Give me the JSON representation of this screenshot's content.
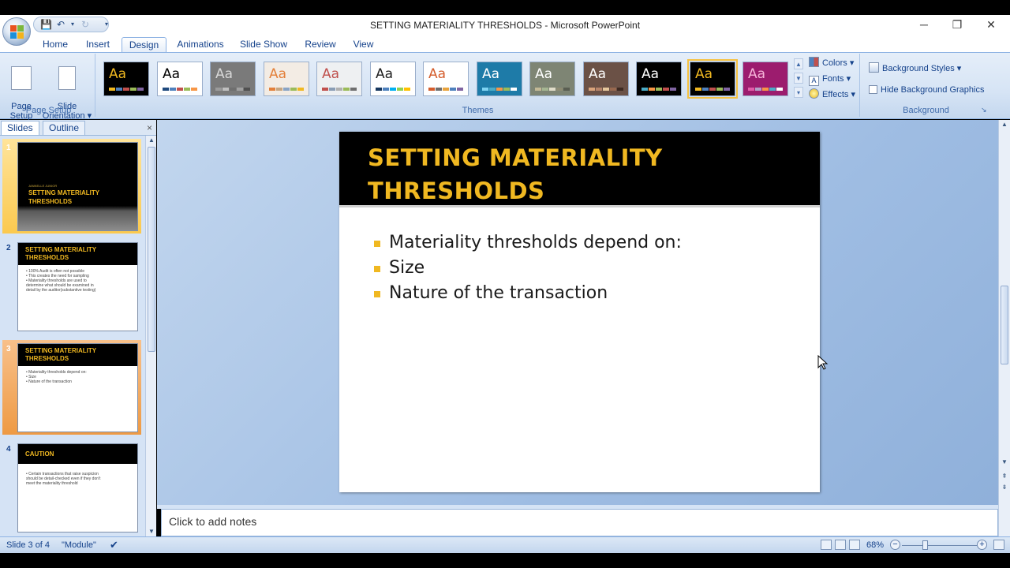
{
  "window": {
    "title": "SETTING MATERIALITY THRESHOLDS - Microsoft PowerPoint",
    "minimize": "─",
    "restore": "❐",
    "close": "✕"
  },
  "qat": {
    "save": "💾",
    "undo": "↶",
    "redo": "↻",
    "more": "▾"
  },
  "ribbon": {
    "tabs": [
      {
        "label": "Home"
      },
      {
        "label": "Insert"
      },
      {
        "label": "Design"
      },
      {
        "label": "Animations"
      },
      {
        "label": "Slide Show"
      },
      {
        "label": "Review"
      },
      {
        "label": "View"
      }
    ],
    "active_tab": "Design",
    "page_setup": {
      "page_setup_label": "Page\nSetup",
      "orientation_label": "Slide\nOrientation ▾",
      "group_label": "Page Setup"
    },
    "themes": {
      "group_label": "Themes",
      "items": [
        {
          "aa": "Aa",
          "bg": "#000000",
          "fg": "#f0b821",
          "bars": [
            "#f0b821",
            "#4f81bd",
            "#c0504d",
            "#9bbb59",
            "#8064a2"
          ]
        },
        {
          "aa": "Aa",
          "bg": "#ffffff",
          "fg": "#000000",
          "bars": [
            "#1f497d",
            "#4f81bd",
            "#c0504d",
            "#9bbb59",
            "#f79646"
          ]
        },
        {
          "aa": "Aa",
          "bg": "#7a7a7a",
          "fg": "#d8d8d8",
          "bars": [
            "#9b9b9b",
            "#c0c0c0",
            "#6f6f6f",
            "#a0a0a0",
            "#505050"
          ]
        },
        {
          "aa": "Aa",
          "bg": "#f3ece4",
          "fg": "#e3803a",
          "bars": [
            "#e3803a",
            "#c6a681",
            "#8aa4c4",
            "#9bbb59",
            "#f0b821"
          ]
        },
        {
          "aa": "Aa",
          "bg": "#eef0f2",
          "fg": "#c0504d",
          "bars": [
            "#c0504d",
            "#8a9db5",
            "#b0b0b0",
            "#9bbb59",
            "#6f6f6f"
          ]
        },
        {
          "aa": "Aa",
          "bg": "#ffffff",
          "fg": "#1f1f1f",
          "bars": [
            "#17375e",
            "#4f81bd",
            "#00b0f0",
            "#92d050",
            "#ffc000"
          ]
        },
        {
          "aa": "Aa",
          "bg": "#ffffff",
          "fg": "#d45d2c",
          "bars": [
            "#d45d2c",
            "#6e6e6e",
            "#e8a33d",
            "#4f81bd",
            "#8064a2"
          ]
        },
        {
          "aa": "Aa",
          "bg": "#1e7ba8",
          "fg": "#ffffff",
          "bars": [
            "#7fd3f2",
            "#4bacc6",
            "#f79646",
            "#9bbb59",
            "#ffffff"
          ]
        },
        {
          "aa": "Aa",
          "bg": "#7e8574",
          "fg": "#ffffff",
          "bars": [
            "#c3b996",
            "#a5b592",
            "#e0dcc9",
            "#8d8b73",
            "#5a5e52"
          ]
        },
        {
          "aa": "Aa",
          "bg": "#6b5146",
          "fg": "#ffffff",
          "bars": [
            "#d9a37b",
            "#b6846a",
            "#e5c79d",
            "#97684f",
            "#3e2a22"
          ]
        },
        {
          "aa": "Aa",
          "bg": "#000000",
          "fg": "#ffffff",
          "bars": [
            "#4bacc6",
            "#f79646",
            "#9bbb59",
            "#c0504d",
            "#8064a2"
          ]
        },
        {
          "aa": "Aa",
          "bg": "#000000",
          "fg": "#f0b821",
          "bars": [
            "#f0b821",
            "#4f81bd",
            "#c0504d",
            "#9bbb59",
            "#8064a2"
          ]
        },
        {
          "aa": "Aa",
          "bg": "#9c1c6e",
          "fg": "#f6b3d8",
          "bars": [
            "#e25ca9",
            "#b2a2c7",
            "#f79646",
            "#4bacc6",
            "#ffffff"
          ]
        }
      ],
      "selected_index": 11,
      "colors_label": "Colors ▾",
      "fonts_label": "Fonts ▾",
      "effects_label": "Effects ▾"
    },
    "background": {
      "styles_label": "Background Styles ▾",
      "hide_graphics_label": "Hide Background Graphics",
      "hide_graphics_checked": false,
      "group_label": "Background",
      "launcher": "↘"
    }
  },
  "slides_pane": {
    "tab_slides": "Slides",
    "tab_outline": "Outline",
    "close": "×",
    "thumbnails": [
      {
        "num": "1",
        "title": "SETTING MATERIALITY\nTHRESHOLDS",
        "subtitle": "JANNELLE JUNIOR",
        "lines": []
      },
      {
        "num": "2",
        "title": "SETTING MATERIALITY\nTHRESHOLDS",
        "lines": [
          "• 100% Audit is often not possible",
          "• This creates the need for sampling",
          "• Materiality thresholds are used to",
          "   determine what should be examined in",
          "   detail by the auditor(substantive testing)"
        ]
      },
      {
        "num": "3",
        "title": "SETTING MATERIALITY\nTHRESHOLDS",
        "lines": [
          "• Materiality thresholds depend on:",
          "• Size",
          "• Nature of the transaction"
        ]
      },
      {
        "num": "4",
        "title": "CAUTION",
        "lines": [
          "• Certain transactions that raise suspicion",
          "   should be detail-checked even if they don't",
          "   meet the materiality threshold"
        ]
      }
    ]
  },
  "slide": {
    "title_line1": "SETTING MATERIALITY",
    "title_line2": "THRESHOLDS",
    "bullets": [
      "Materiality thresholds  depend  on:",
      "Size",
      "Nature  of the transaction"
    ]
  },
  "notes": {
    "placeholder": "Click to add notes"
  },
  "status": {
    "slide_info": "Slide 3 of 4",
    "theme_name": "\"Module\"",
    "zoom": "68%",
    "zoom_out": "−",
    "zoom_in": "+"
  }
}
